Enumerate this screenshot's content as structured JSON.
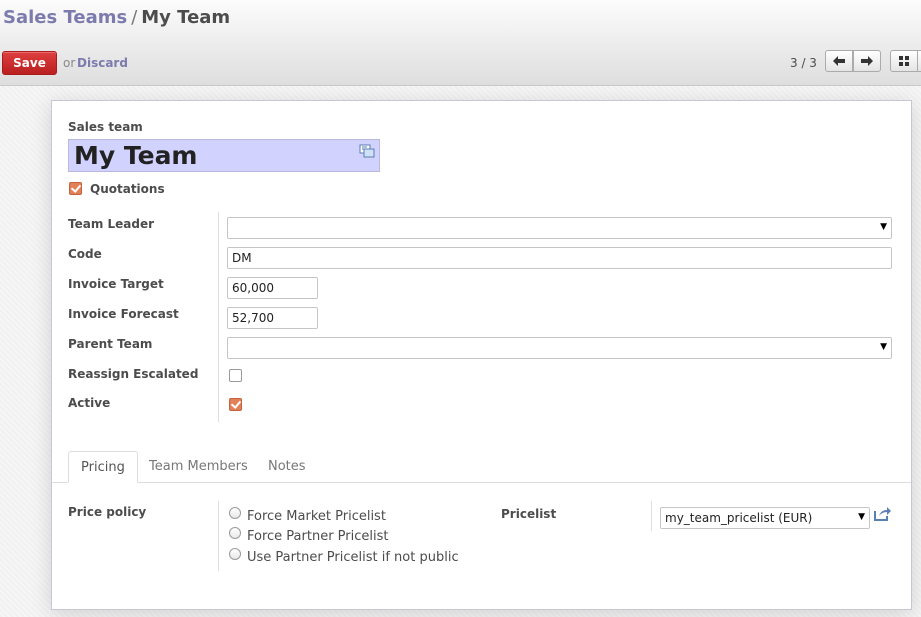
{
  "breadcrumb": {
    "parent": "Sales Teams",
    "separator": "/",
    "current": "My Team"
  },
  "toolbar": {
    "save_label": "Save",
    "or_label": "or",
    "discard_label": "Discard"
  },
  "pager": {
    "value": "3 / 3"
  },
  "icons": {
    "prev": "arrow-left-icon",
    "next": "arrow-right-icon",
    "kanban": "kanban-view-icon",
    "translate": "translate-icon",
    "external": "external-link-icon"
  },
  "colors": {
    "accent": "#7c7bad",
    "save": "#d53535",
    "checkbox": "#e2805a",
    "title_bg": "#d2d2ff"
  },
  "form": {
    "sales_team_label": "Sales team",
    "name_value": "My Team",
    "quotations": {
      "label": "Quotations",
      "checked": true
    },
    "team_leader": {
      "label": "Team Leader",
      "value": ""
    },
    "code": {
      "label": "Code",
      "value": "DM"
    },
    "invoice_target": {
      "label": "Invoice Target",
      "value": "60,000"
    },
    "invoice_forecast": {
      "label": "Invoice Forecast",
      "value": "52,700"
    },
    "parent_team": {
      "label": "Parent Team",
      "value": ""
    },
    "reassign_escalated": {
      "label": "Reassign Escalated",
      "checked": false
    },
    "active": {
      "label": "Active",
      "checked": true
    }
  },
  "tabs": [
    {
      "label": "Pricing",
      "active": true
    },
    {
      "label": "Team Members",
      "active": false
    },
    {
      "label": "Notes",
      "active": false
    }
  ],
  "pricing": {
    "price_policy_label": "Price policy",
    "options": [
      "Force Market Pricelist",
      "Force Partner Pricelist",
      "Use Partner Pricelist if not public"
    ],
    "selected_option": null,
    "pricelist_label": "Pricelist",
    "pricelist_value": "my_team_pricelist (EUR)"
  }
}
